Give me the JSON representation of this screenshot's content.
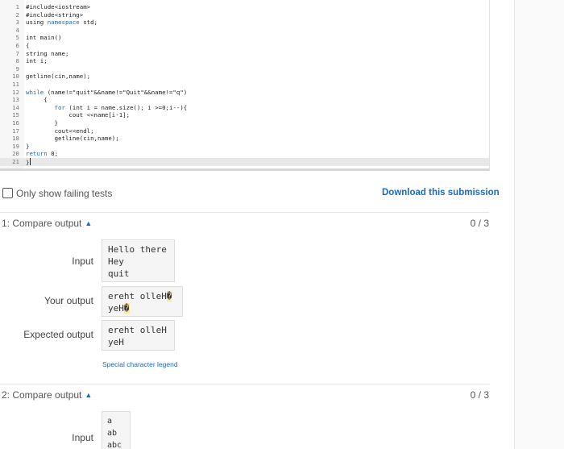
{
  "editor": {
    "lines": [
      {
        "n": "1",
        "text": "#include<iostream>"
      },
      {
        "n": "2",
        "text": "#include<string>"
      },
      {
        "n": "3",
        "pre": "using ",
        "kw": "namespace",
        "post": " std;"
      },
      {
        "n": "4",
        "text": ""
      },
      {
        "n": "5",
        "text": "int main()"
      },
      {
        "n": "6",
        "text": "{"
      },
      {
        "n": "7",
        "text": "string name;"
      },
      {
        "n": "8",
        "text": "int i;"
      },
      {
        "n": "9",
        "text": ""
      },
      {
        "n": "10",
        "text": "getline(cin,name);"
      },
      {
        "n": "11",
        "text": ""
      },
      {
        "n": "12",
        "pre": "",
        "kw": "while",
        "post": " (name!=\"quit\"&&name!=\"Quit\"&&name!=\"q\")"
      },
      {
        "n": "13",
        "text": "     {"
      },
      {
        "n": "14",
        "pre": "        ",
        "kw": "for",
        "post": " (int i = name.size(); i >=0;i--){"
      },
      {
        "n": "15",
        "text": "            cout <<name[i-1];"
      },
      {
        "n": "16",
        "text": "        }"
      },
      {
        "n": "17",
        "text": "        cout<<endl;"
      },
      {
        "n": "18",
        "text": "        getline(cin,name);"
      },
      {
        "n": "19",
        "text": "}"
      },
      {
        "n": "20",
        "pre": "",
        "kw": "return",
        "post": " 0;"
      },
      {
        "n": "21",
        "text": "}"
      }
    ]
  },
  "filter": {
    "only_failing_label": "Only show failing tests",
    "download_label": "Download this submission"
  },
  "tests": [
    {
      "title": "1: Compare output",
      "score": "0 / 3",
      "input_label": "Input",
      "input_lines": [
        "Hello there",
        "Hey",
        "quit"
      ],
      "your_output_label": "Your output",
      "your_output_lines": [
        "ereht olleH",
        "yeH"
      ],
      "replacement_char": "�",
      "expected_output_label": "Expected output",
      "expected_output_lines": [
        "ereht olleH",
        "yeH"
      ],
      "legend_label": "Special character legend"
    },
    {
      "title": "2: Compare output",
      "score": "0 / 3",
      "input_label": "Input",
      "input_lines": [
        "a",
        "ab",
        "abc"
      ]
    }
  ],
  "colors": {
    "accent": "#1a6bb8",
    "highlight": "#f8e6b0",
    "box_bg": "#f5f5f5"
  },
  "icons": {
    "caret": "caret-up-icon",
    "checkbox": "checkbox-unchecked-icon"
  }
}
